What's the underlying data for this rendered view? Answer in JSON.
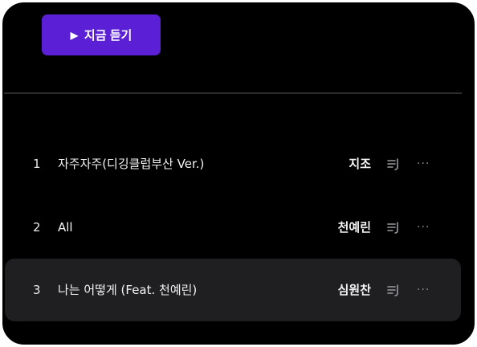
{
  "play_button": {
    "label": "지금 듣기",
    "icon": "play-icon"
  },
  "tracks": [
    {
      "number": "1",
      "title": "자주자주(디깅클럽부산 Ver.)",
      "artist": "지조",
      "active": false
    },
    {
      "number": "2",
      "title": "All",
      "artist": "천예린",
      "active": false
    },
    {
      "number": "3",
      "title": "나는 어떻게 (Feat. 천예린)",
      "artist": "심원찬",
      "active": true
    }
  ],
  "icons": {
    "queue": "add-to-queue-icon",
    "more": "more-options-icon",
    "more_glyph": "···"
  },
  "colors": {
    "accent": "#5b1fd6",
    "background": "#000000",
    "active_row": "#1f1f22"
  }
}
